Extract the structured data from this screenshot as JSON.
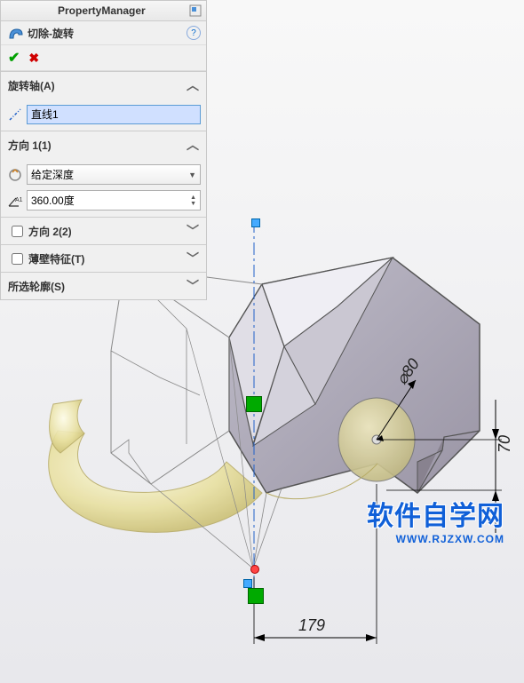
{
  "header": {
    "title": "PropertyManager"
  },
  "feature": {
    "title": "切除-旋转"
  },
  "axis": {
    "label": "旋转轴(A)",
    "value": "直线1"
  },
  "dir1": {
    "label": "方向 1(1)",
    "type": "给定深度",
    "angle": "360.00度"
  },
  "dir2": {
    "label": "方向 2(2)"
  },
  "thin": {
    "label": "薄壁特征(T)"
  },
  "contours": {
    "label": "所选轮廓(S)"
  },
  "dims": {
    "dia": "⌀80",
    "v": "70",
    "h": "179"
  },
  "watermark": {
    "line1": "软件自学网",
    "line2": "WWW.RJZXW.COM"
  }
}
